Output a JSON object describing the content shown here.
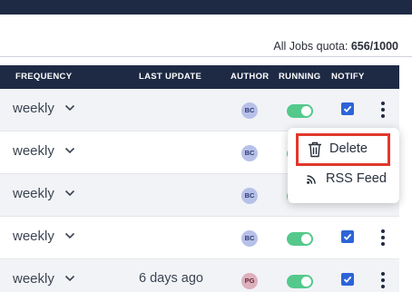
{
  "quota": {
    "label": "All Jobs quota:",
    "value": "656/1000"
  },
  "table": {
    "columns": {
      "frequency": "FREQUENCY",
      "last_update": "LAST UPDATE",
      "author": "AUTHOR",
      "running": "RUNNING",
      "notify": "NOTIFY"
    },
    "rows": [
      {
        "frequency": "weekly",
        "last_update": "",
        "author": "BC",
        "running": true,
        "notify": true
      },
      {
        "frequency": "weekly",
        "last_update": "",
        "author": "BC",
        "running": true,
        "notify": true
      },
      {
        "frequency": "weekly",
        "last_update": "",
        "author": "BC",
        "running": true,
        "notify": true
      },
      {
        "frequency": "weekly",
        "last_update": "",
        "author": "BC",
        "running": true,
        "notify": true
      },
      {
        "frequency": "weekly",
        "last_update": "6 days ago",
        "author": "PG",
        "running": true,
        "notify": true
      }
    ]
  },
  "menu": {
    "delete_label": "Delete",
    "rss_label": "RSS Feed",
    "delete_icon": "trash-icon",
    "rss_icon": "rss-icon"
  },
  "colors": {
    "navy": "#1e2a44",
    "toggle_on": "#54c98b",
    "checkbox": "#2c64d8",
    "highlight": "#e0382c",
    "avatar_bc": "#b7c1e8",
    "avatar_pg": "#dcb0bc"
  }
}
